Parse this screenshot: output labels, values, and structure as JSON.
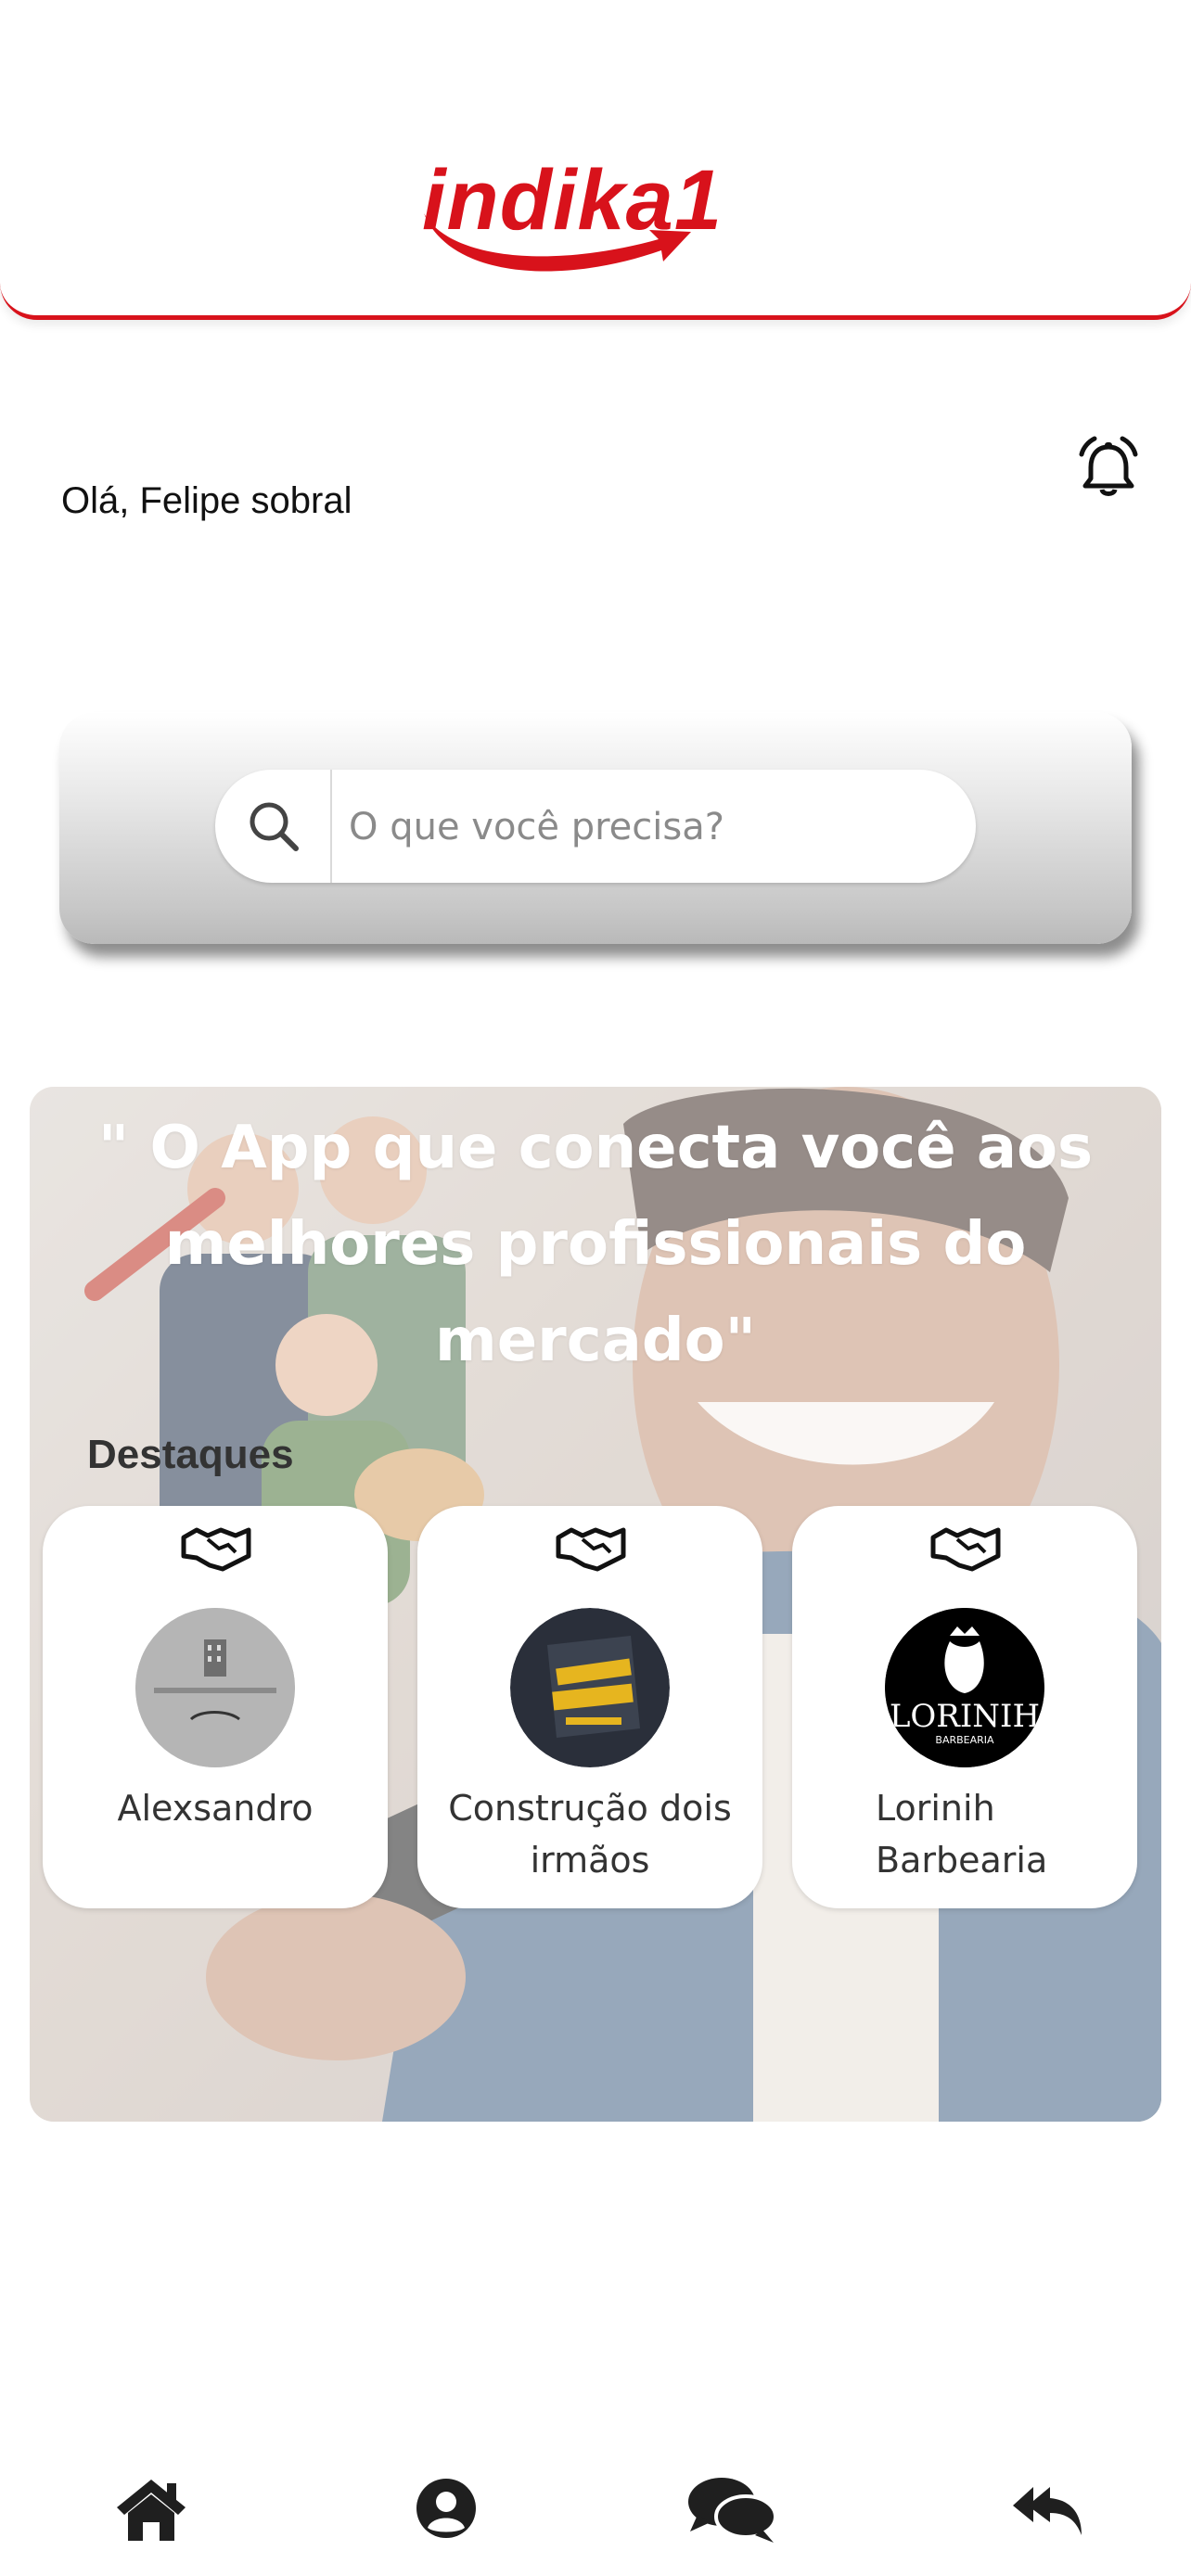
{
  "header": {
    "logo_text": "indika1"
  },
  "greeting": "Olá, Felipe sobral",
  "search": {
    "placeholder": "O que você precisa?"
  },
  "hero": {
    "quote": "\" O App que conecta você aos melhores profissionais  do mercado\"",
    "section_title": "Destaques"
  },
  "featured": [
    {
      "name": "Alexsandro",
      "avatar_icon": "building-logo"
    },
    {
      "name": "Construção dois irmãos",
      "avatar_icon": "dois-irmaos-logo"
    },
    {
      "name": "Lorinih Barbearia",
      "avatar_icon": "lorinih-logo",
      "avatar_text": "LORINIH",
      "avatar_subtext": "BARBEARIA"
    }
  ],
  "nav": [
    "home-icon",
    "profile-icon",
    "chat-icon",
    "reply-icon"
  ],
  "colors": {
    "brand": "#d8121b",
    "icon": "#1f1f1f"
  }
}
